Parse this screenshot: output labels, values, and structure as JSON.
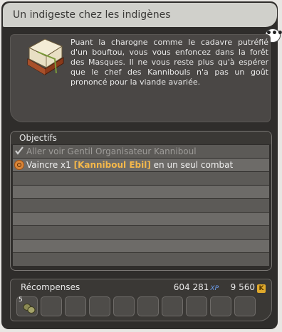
{
  "window": {
    "title": "Un indigeste chez les indigènes"
  },
  "chat_bubble_label": "•••",
  "description": "Puant la charogne comme le cadavre putréfié d'un bouftou, vous vous enfoncez dans la forêt des Masques. Il ne vous reste plus qu'à espérer que le chef des Kannibouls n'a pas un goût prononcé pour la viande avariée.",
  "objectives": {
    "header": "Objectifs",
    "items": [
      {
        "label": "Aller voir Gentil Organisateur Kanniboul",
        "done": true,
        "icon": "check-icon"
      },
      {
        "prefix": "Vaincre x1 ",
        "monster": "[Kanniboul Ebil]",
        "suffix": " en un seul combat",
        "done": false,
        "icon": "combat-icon"
      }
    ]
  },
  "rewards": {
    "title": "Récompenses",
    "xp": "604 281",
    "xp_label": "XP",
    "kamas": "9 560",
    "kamas_label": "K",
    "items": [
      {
        "quantity": "5",
        "icon": "seed-item-icon"
      }
    ]
  },
  "colors": {
    "monster_highlight": "#f5b84a",
    "xp_label": "#6c9ef0",
    "kamas_badge": "#e0a92b"
  }
}
